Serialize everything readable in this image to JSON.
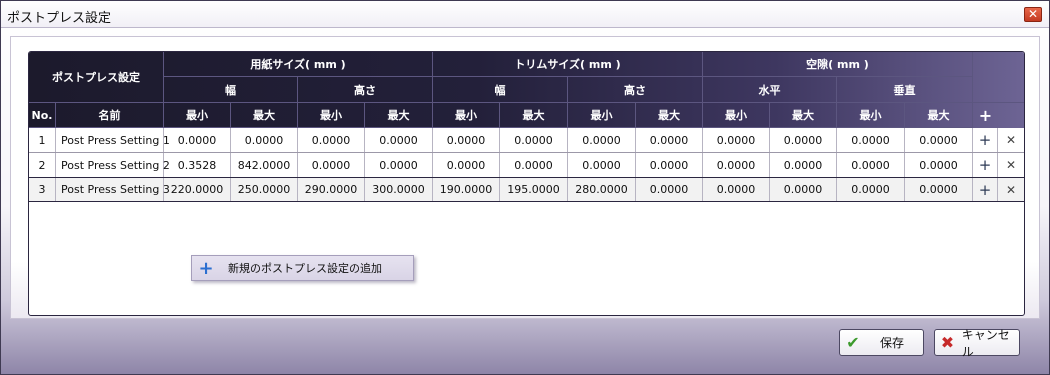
{
  "window": {
    "title": "ポストプレス設定",
    "close_glyph": "✕"
  },
  "table": {
    "header": {
      "group_title": "ポストプレス設定",
      "paper_size": "用紙サイズ( mm )",
      "trim_size": "トリムサイズ( mm )",
      "gap": "空隙( mm )",
      "width": "幅",
      "height": "高さ",
      "horizontal": "水平",
      "vertical": "垂直",
      "min": "最小",
      "max": "最大",
      "no": "No.",
      "name": "名前",
      "add_glyph": "+"
    },
    "rows": [
      {
        "no": "1",
        "name": "Post Press Setting 1",
        "values": [
          "0.0000",
          "0.0000",
          "0.0000",
          "0.0000",
          "0.0000",
          "0.0000",
          "0.0000",
          "0.0000",
          "0.0000",
          "0.0000",
          "0.0000",
          "0.0000"
        ]
      },
      {
        "no": "2",
        "name": "Post Press Setting 2",
        "values": [
          "0.3528",
          "842.0000",
          "0.0000",
          "0.0000",
          "0.0000",
          "0.0000",
          "0.0000",
          "0.0000",
          "0.0000",
          "0.0000",
          "0.0000",
          "0.0000"
        ]
      },
      {
        "no": "3",
        "name": "Post Press Setting 3",
        "values": [
          "220.0000",
          "250.0000",
          "290.0000",
          "300.0000",
          "190.0000",
          "195.0000",
          "280.0000",
          "0.0000",
          "0.0000",
          "0.0000",
          "0.0000",
          "0.0000"
        ]
      }
    ],
    "row_add_glyph": "+",
    "row_delete_glyph": "✕"
  },
  "context_menu": {
    "add_glyph": "+",
    "add_label": "新規のポストプレス設定の追加"
  },
  "footer": {
    "save_label": "保存",
    "cancel_label": "キャンセル"
  },
  "colors": {
    "header_dark": "#1c1a2c",
    "header_light": "#6d6494",
    "accent_blue": "#2b6fd0",
    "ok_green": "#3c9a2d",
    "cancel_red": "#c62a2a"
  }
}
